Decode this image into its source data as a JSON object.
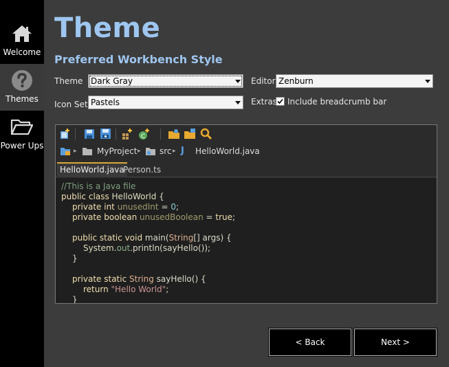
{
  "sidebar": {
    "items": [
      {
        "label": "Welcome",
        "icon": "home-icon",
        "active": false
      },
      {
        "label": "Themes",
        "icon": "question-icon",
        "active": true
      },
      {
        "label": "Power Ups",
        "icon": "folder-icon",
        "active": false
      }
    ]
  },
  "header": {
    "title": "Theme",
    "subtitle": "Preferred Workbench Style"
  },
  "form": {
    "theme_label": "Theme",
    "theme_value": "Dark Gray",
    "editor_label": "Editor",
    "editor_value": "Zenburn",
    "iconset_label": "Icon Set",
    "iconset_value": "Pastels",
    "extras_label": "Extras",
    "breadcrumb_checkbox_label": "Include breadcrumb bar",
    "breadcrumb_checked": true
  },
  "preview": {
    "toolbar_icons": [
      "new-icon",
      "save-icon",
      "save-all-icon",
      "new-package-icon",
      "new-class-icon",
      "open-folder-icon",
      "open-type-icon",
      "search-icon"
    ],
    "breadcrumb": {
      "project": "MyProject",
      "folder": "src",
      "file": "HelloWorld.java"
    },
    "tabs": [
      "HelloWorld.java",
      "Person.ts"
    ],
    "code": {
      "comment": "//This is a Java file",
      "l2_kw": "public class ",
      "l2_cls": "HelloWorld",
      "l2_end": " {",
      "l3_kw": "private int ",
      "l3_var": "unusedInt",
      "l3_op": " = ",
      "l3_num": "0",
      "l3_end": ";",
      "l4_kw": "private boolean ",
      "l4_var": "unusedBoolean",
      "l4_op": " = ",
      "l4_val": "true",
      "l4_end": ";",
      "l6_kw": "public static void ",
      "l6_fn": "main(",
      "l6_type": "String",
      "l6_rest": "[] args) {",
      "l7_cls": "System.",
      "l7_fld": "out",
      "l7_rest": ".println(sayHello());",
      "l8": "}",
      "l10_kw": "private static ",
      "l10_type": "String",
      "l10_rest": " sayHello() {",
      "l11_kw": "return ",
      "l11_str": "\"Hello World\"",
      "l11_end": ";",
      "l12": "}"
    }
  },
  "buttons": {
    "back": "< Back",
    "next": "Next >"
  }
}
